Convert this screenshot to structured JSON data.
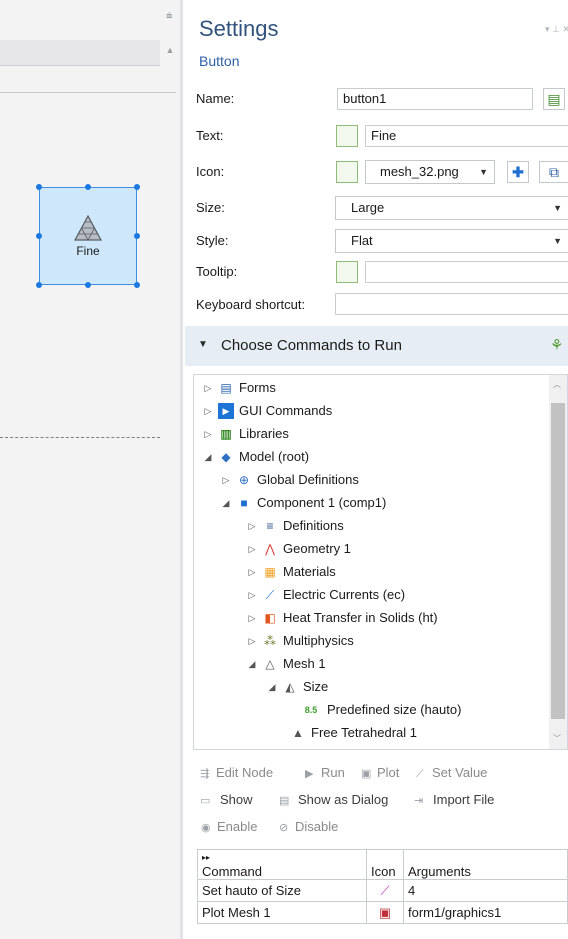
{
  "canvas": {
    "button_label": "Fine"
  },
  "settings": {
    "title": "Settings",
    "subtitle": "Button",
    "fields": {
      "name_label": "Name:",
      "name_value": "button1",
      "text_label": "Text:",
      "text_value": "Fine",
      "icon_label": "Icon:",
      "icon_value": "mesh_32.png",
      "size_label": "Size:",
      "size_value": "Large",
      "style_label": "Style:",
      "style_value": "Flat",
      "tooltip_label": "Tooltip:",
      "tooltip_value": "",
      "shortcut_label": "Keyboard shortcut:",
      "shortcut_value": ""
    },
    "commands_section": {
      "title": "Choose Commands to Run",
      "tree": [
        {
          "label": "Forms",
          "icon": "forms-icon"
        },
        {
          "label": "GUI Commands",
          "icon": "gui-commands-icon"
        },
        {
          "label": "Libraries",
          "icon": "libraries-icon"
        },
        {
          "label": "Model (root)",
          "icon": "model-icon"
        },
        {
          "label": "Global Definitions",
          "icon": "globe-icon"
        },
        {
          "label": "Component 1 (comp1)",
          "icon": "component-icon"
        },
        {
          "label": "Definitions",
          "icon": "definitions-icon"
        },
        {
          "label": "Geometry 1",
          "icon": "geometry-icon"
        },
        {
          "label": "Materials",
          "icon": "materials-icon"
        },
        {
          "label": "Electric Currents (ec)",
          "icon": "electric-currents-icon"
        },
        {
          "label": "Heat Transfer in Solids (ht)",
          "icon": "heat-transfer-icon"
        },
        {
          "label": "Multiphysics",
          "icon": "multiphysics-icon"
        },
        {
          "label": "Mesh 1",
          "icon": "mesh-icon"
        },
        {
          "label": "Size",
          "icon": "size-icon"
        },
        {
          "label": "Predefined size (hauto)",
          "icon": "predefined-size-icon",
          "badge": "8.5"
        },
        {
          "label": "Free Tetrahedral 1",
          "icon": "free-tetrahedral-icon"
        }
      ]
    },
    "actions": {
      "edit_node": "Edit Node",
      "run": "Run",
      "plot": "Plot",
      "set_value": "Set Value",
      "show": "Show",
      "show_as_dialog": "Show as Dialog",
      "import_file": "Import File",
      "enable": "Enable",
      "disable": "Disable"
    },
    "table": {
      "headers": [
        "Command",
        "Icon",
        "Arguments"
      ],
      "rows": [
        {
          "command": "Set hauto of Size",
          "icon": "set-value-icon",
          "arguments": "4"
        },
        {
          "command": "Plot Mesh 1",
          "icon": "plot-icon",
          "arguments": "form1/graphics1"
        }
      ]
    }
  }
}
